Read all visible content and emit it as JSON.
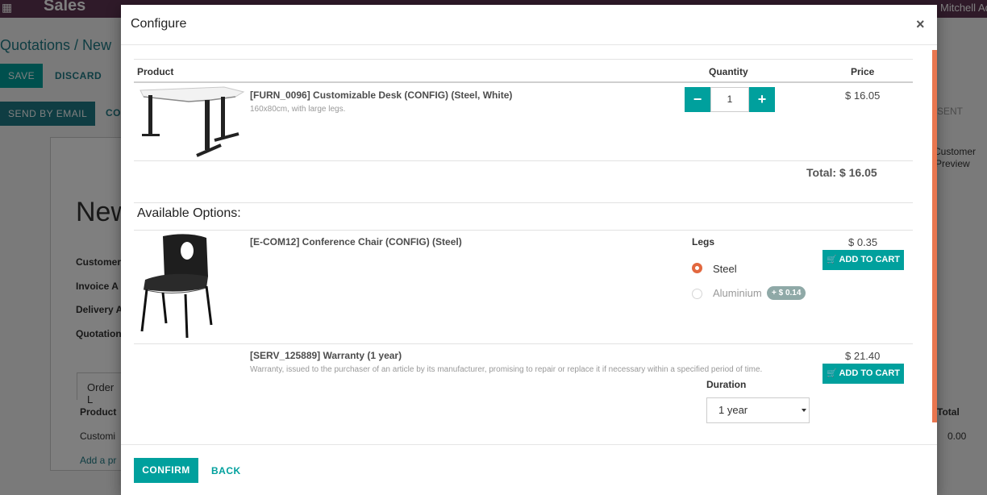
{
  "background": {
    "app_name": "Sales",
    "user_fragment": "Mitchell Adr",
    "breadcrumb": "Quotations / New",
    "save_label": "SAVE",
    "discard_label": "DISCARD",
    "send_email_label": "SEND BY EMAIL",
    "co_fragment": "CO",
    "record_title": "New",
    "field_labels": [
      "Customer",
      "Invoice A",
      "Delivery A",
      "Quotation"
    ],
    "tab_label": "Order L",
    "table_header_product": "Product",
    "row_text": "Customi",
    "add_line": "Add a pr",
    "right_customer": "Customer",
    "right_preview": "Preview",
    "right_total_header": "Total",
    "right_total_value": "0.00",
    "right_sent": "SENT"
  },
  "modal": {
    "title": "Configure",
    "close_symbol": "×",
    "headers": {
      "product": "Product",
      "quantity": "Quantity",
      "price": "Price"
    },
    "main_product": {
      "name": "[FURN_0096] Customizable Desk (CONFIG) (Steel, White)",
      "description": "160x80cm, with large legs.",
      "quantity": "1",
      "price": "$ 16.05"
    },
    "total_label": "Total: $ 16.05",
    "options_title": "Available Options:",
    "options": [
      {
        "name": "[E-COM12] Conference Chair (CONFIG) (Steel)",
        "attribute_label": "Legs",
        "values": [
          {
            "label": "Steel",
            "selected": true
          },
          {
            "label": "Aluminium",
            "selected": false,
            "extra": "+ $ 0.14"
          }
        ],
        "price": "$ 0.35",
        "add_label": "ADD TO CART"
      },
      {
        "name": "[SERV_125889] Warranty (1 year)",
        "description": "Warranty, issued to the purchaser of an article by its manufacturer, promising to repair or replace it if necessary within a specified period of time.",
        "attribute_label": "Duration",
        "selected_value": "1 year",
        "price": "$ 21.40",
        "add_label": "ADD TO CART"
      }
    ],
    "confirm_label": "CONFIRM",
    "back_label": "BACK"
  },
  "colors": {
    "primary": "#00a09d",
    "radio_active": "#e2683f",
    "topbar": "#5e3553",
    "scroll_accent": "#e9764f"
  },
  "icons": [
    "apps-grid-icon",
    "close-icon",
    "minus-icon",
    "plus-icon",
    "cart-icon",
    "dropdown-caret-icon"
  ]
}
